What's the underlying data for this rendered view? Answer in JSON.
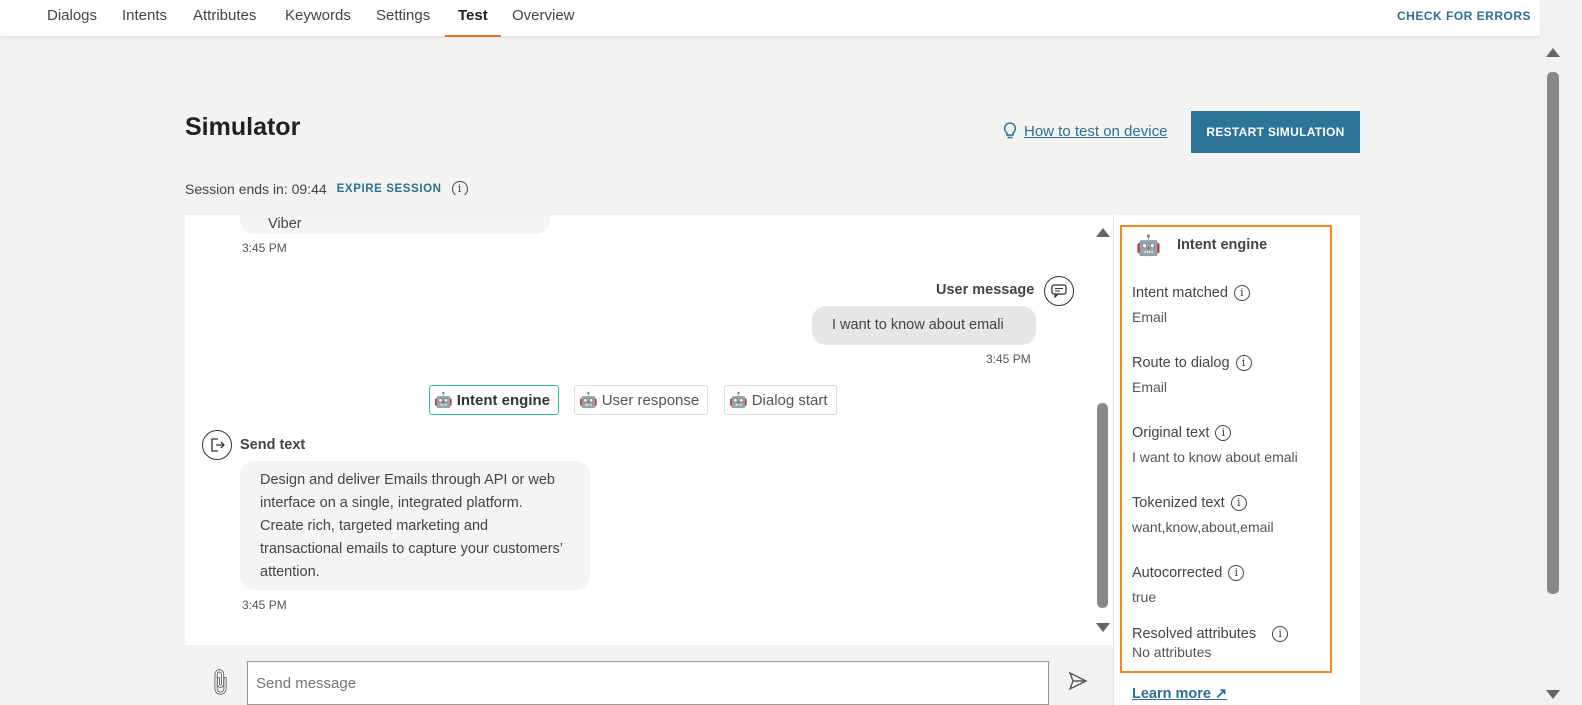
{
  "nav": {
    "tabs": [
      "Dialogs",
      "Intents",
      "Attributes",
      "Keywords",
      "Settings",
      "Test",
      "Overview"
    ],
    "active": "Test",
    "check_errors": "CHECK FOR ERRORS"
  },
  "header": {
    "title": "Simulator",
    "how_to": "How to test on device",
    "restart": "RESTART SIMULATION",
    "session_label": "Session ends in: 09:44",
    "expire": "EXPIRE SESSION"
  },
  "chat": {
    "prev_bubble_text": "Viber",
    "prev_time": "3:45 PM",
    "user_label": "User message",
    "user_text": "I want to know about emali",
    "user_time": "3:45 PM",
    "chips": [
      "Intent engine",
      "User response",
      "Dialog start"
    ],
    "send_label": "Send text",
    "send_text": "Design and deliver Emails through API or web interface on a single, integrated platform. Create rich, targeted marketing and transactional emails to capture your customers’ attention.",
    "send_time": "3:45 PM",
    "input_placeholder": "Send message"
  },
  "intent_panel": {
    "title": "Intent engine",
    "fields": [
      {
        "label": "Intent matched",
        "value": "Email"
      },
      {
        "label": "Route to dialog",
        "value": "Email"
      },
      {
        "label": "Original text",
        "value": "I want to know about emali"
      },
      {
        "label": "Tokenized text",
        "value": "want,know,about,email"
      },
      {
        "label": "Autocorrected",
        "value": "true"
      },
      {
        "label": "Resolved attributes",
        "value": "No attributes"
      }
    ],
    "learn_more": "Learn more"
  },
  "colors": {
    "accent": "#2c7398",
    "tab_underline": "#f06a22",
    "highlight": "#f5871f",
    "chip_active": "#2fbf9a"
  }
}
